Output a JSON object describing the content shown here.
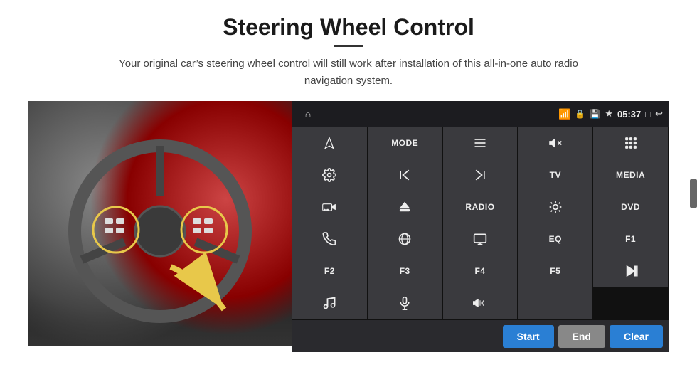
{
  "header": {
    "title": "Steering Wheel Control",
    "subtitle": "Your original car’s steering wheel control will still work after installation of this all-in-one auto radio navigation system."
  },
  "panel": {
    "time": "05:37",
    "buttons": [
      {
        "id": "nav",
        "type": "icon",
        "icon": "nav",
        "label": ""
      },
      {
        "id": "mode",
        "type": "text",
        "icon": "",
        "label": "MODE"
      },
      {
        "id": "list",
        "type": "icon",
        "icon": "list",
        "label": ""
      },
      {
        "id": "mute",
        "type": "icon",
        "icon": "mute",
        "label": ""
      },
      {
        "id": "apps",
        "type": "icon",
        "icon": "apps",
        "label": ""
      },
      {
        "id": "settings",
        "type": "icon",
        "icon": "settings",
        "label": ""
      },
      {
        "id": "prev",
        "type": "icon",
        "icon": "prev",
        "label": ""
      },
      {
        "id": "next",
        "type": "icon",
        "icon": "next",
        "label": ""
      },
      {
        "id": "tv",
        "type": "text",
        "icon": "",
        "label": "TV"
      },
      {
        "id": "media",
        "type": "text",
        "icon": "",
        "label": "MEDIA"
      },
      {
        "id": "cam360",
        "type": "icon",
        "icon": "360cam",
        "label": ""
      },
      {
        "id": "eject",
        "type": "icon",
        "icon": "eject",
        "label": ""
      },
      {
        "id": "radio",
        "type": "text",
        "icon": "",
        "label": "RADIO"
      },
      {
        "id": "bright",
        "type": "icon",
        "icon": "bright",
        "label": ""
      },
      {
        "id": "dvd",
        "type": "text",
        "icon": "",
        "label": "DVD"
      },
      {
        "id": "phone",
        "type": "icon",
        "icon": "phone",
        "label": ""
      },
      {
        "id": "globe",
        "type": "icon",
        "icon": "globe",
        "label": ""
      },
      {
        "id": "screen",
        "type": "icon",
        "icon": "screen",
        "label": ""
      },
      {
        "id": "eq",
        "type": "text",
        "icon": "",
        "label": "EQ"
      },
      {
        "id": "f1",
        "type": "text",
        "icon": "",
        "label": "F1"
      },
      {
        "id": "f2",
        "type": "text",
        "icon": "",
        "label": "F2"
      },
      {
        "id": "f3",
        "type": "text",
        "icon": "",
        "label": "F3"
      },
      {
        "id": "f4",
        "type": "text",
        "icon": "",
        "label": "F4"
      },
      {
        "id": "f5",
        "type": "text",
        "icon": "",
        "label": "F5"
      },
      {
        "id": "playpause",
        "type": "icon",
        "icon": "playpause",
        "label": ""
      },
      {
        "id": "music",
        "type": "icon",
        "icon": "music",
        "label": ""
      },
      {
        "id": "mic",
        "type": "icon",
        "icon": "mic",
        "label": ""
      },
      {
        "id": "volphone",
        "type": "icon",
        "icon": "volphone",
        "label": ""
      },
      {
        "id": "empty1",
        "type": "text",
        "icon": "",
        "label": ""
      }
    ],
    "bottom_buttons": {
      "start": "Start",
      "end": "End",
      "clear": "Clear"
    }
  }
}
